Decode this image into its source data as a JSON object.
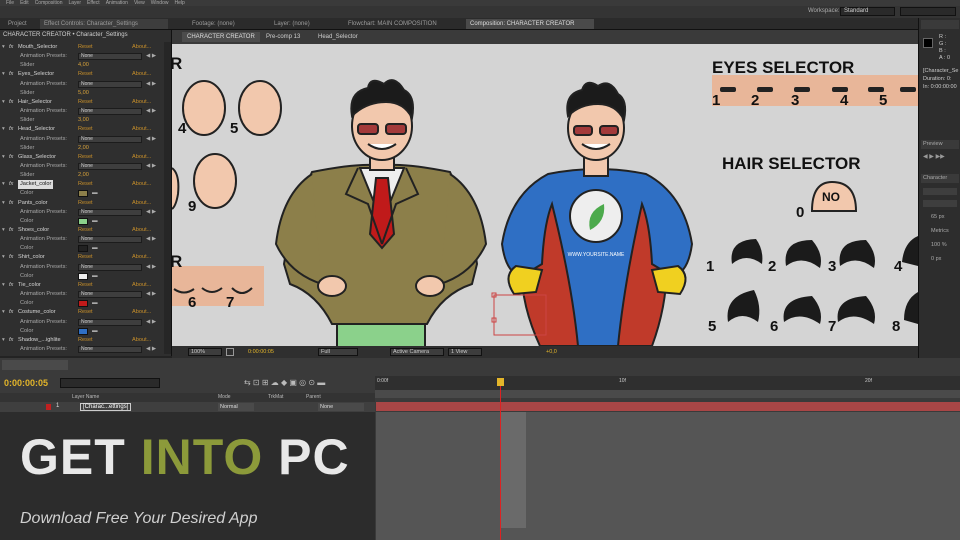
{
  "workspace": {
    "label": "Workspace:",
    "value": "Standard"
  },
  "left_panel": {
    "breadcrumb": "CHARACTER CREATOR • Character_Settings",
    "reset": "Reset",
    "about": "About...",
    "rows": [
      {
        "kind": "effect",
        "label": "Mouth_Selector"
      },
      {
        "kind": "preset",
        "label": "Animation Presets:",
        "value": "None"
      },
      {
        "kind": "slider",
        "label": "Slider",
        "value": "4,00"
      },
      {
        "kind": "effect",
        "label": "Eyes_Selector"
      },
      {
        "kind": "preset",
        "label": "Animation Presets:",
        "value": "None"
      },
      {
        "kind": "slider",
        "label": "Slider",
        "value": "5,00"
      },
      {
        "kind": "effect",
        "label": "Hair_Selector"
      },
      {
        "kind": "preset",
        "label": "Animation Presets:",
        "value": "None"
      },
      {
        "kind": "slider",
        "label": "Slider",
        "value": "3,00"
      },
      {
        "kind": "effect",
        "label": "Head_Selector"
      },
      {
        "kind": "preset",
        "label": "Animation Presets:",
        "value": "None"
      },
      {
        "kind": "slider",
        "label": "Slider",
        "value": "2,00"
      },
      {
        "kind": "effect",
        "label": "Glass_Selector"
      },
      {
        "kind": "preset",
        "label": "Animation Presets:",
        "value": "None"
      },
      {
        "kind": "slider",
        "label": "Slider",
        "value": "2,00"
      },
      {
        "kind": "effect",
        "label": "Jacket_color",
        "selected": true
      },
      {
        "kind": "color",
        "label": "Color",
        "color": "#8c7f4a"
      },
      {
        "kind": "effect",
        "label": "Pants_color"
      },
      {
        "kind": "preset",
        "label": "Animation Presets:",
        "value": "None"
      },
      {
        "kind": "color",
        "label": "Color",
        "color": "#8bd18b"
      },
      {
        "kind": "effect",
        "label": "Shoes_color"
      },
      {
        "kind": "preset",
        "label": "Animation Presets:",
        "value": "None"
      },
      {
        "kind": "color",
        "label": "Color",
        "color": "#222222"
      },
      {
        "kind": "effect",
        "label": "Shirt_color"
      },
      {
        "kind": "preset",
        "label": "Animation Presets:",
        "value": "None"
      },
      {
        "kind": "color",
        "label": "Color",
        "color": "#eeeeee"
      },
      {
        "kind": "effect",
        "label": "Tie_color"
      },
      {
        "kind": "preset",
        "label": "Animation Presets:",
        "value": "None"
      },
      {
        "kind": "color",
        "label": "Color",
        "color": "#c01a1a"
      },
      {
        "kind": "effect",
        "label": "Costume_color"
      },
      {
        "kind": "preset",
        "label": "Animation Presets:",
        "value": "None"
      },
      {
        "kind": "color",
        "label": "Color",
        "color": "#2f6fc4"
      },
      {
        "kind": "effect",
        "label": "Shadow_...ighlite"
      },
      {
        "kind": "preset",
        "label": "Animation Presets:",
        "value": "None"
      }
    ]
  },
  "tabs": [
    {
      "label": "Footage: (none)"
    },
    {
      "label": "Layer: (none)"
    },
    {
      "label": "Flowchart: MAIN COMPOSITION"
    },
    {
      "label": "Composition: CHARACTER CREATOR",
      "active": true
    }
  ],
  "comp_breadcrumbs": [
    "CHARACTER CREATOR",
    "Pre-comp 13",
    "Head_Selector"
  ],
  "canvas": {
    "eyes_title": "EYES SELECTOR",
    "eyes_numbers": [
      "1",
      "2",
      "3",
      "4",
      "5"
    ],
    "hair_title": "HAIR SELECTOR",
    "hair_none_number": "0",
    "hair_none_label": "NO",
    "hair_numbers": [
      "1",
      "2",
      "3",
      "4",
      "5",
      "6",
      "7",
      "8"
    ],
    "head_numbers": [
      "4",
      "5",
      "9"
    ],
    "mouth_numbers": [
      "6",
      "7"
    ],
    "hero_logo_text": "WWW.YOURSITE.NAME",
    "partial_left_letter": "R"
  },
  "viewer_controls": {
    "zoom": "100%",
    "timecode": "0:00:00:05",
    "resolution": "Full",
    "camera": "Active Camera",
    "views": "1 View",
    "offset": "+0,0"
  },
  "right_panel": {
    "info_lines": [
      "R :",
      "G :",
      "B :",
      "A : 0"
    ],
    "comp_name": "[Character_Se",
    "comp_detail": "Duration: 0:",
    "comp_detail2": "In: 0:00:00:00",
    "sections": [
      "Preview",
      "Character"
    ],
    "fields": [
      "65 px",
      "Metrics",
      "100 %",
      "0 px"
    ]
  },
  "timeline": {
    "timecode": "0:00:00:05",
    "col_headers": [
      "Layer Name",
      "Mode",
      "TrkMat",
      "Parent"
    ],
    "layer_index": "1",
    "layer_name": "[Charac...ettings]",
    "layer_mode": "Normal",
    "layer_parent": "None",
    "ruler_marks": [
      "0:00f",
      "10f",
      "20f"
    ]
  },
  "watermark": {
    "title_parts": [
      "GET ",
      "INTO ",
      "PC"
    ],
    "subtitle": "Download Free Your Desired App"
  },
  "colors": {
    "accent_orange": "#d7a23a",
    "timecode_yellow": "#e3b52a",
    "watermark_green": "#8c9a3a",
    "jacket": "#8c7f4a",
    "tie": "#c01a1a",
    "costume": "#2f6fc4",
    "cape": "#c03a2a",
    "glove": "#f0d020",
    "skin": "#f2c8ad"
  }
}
